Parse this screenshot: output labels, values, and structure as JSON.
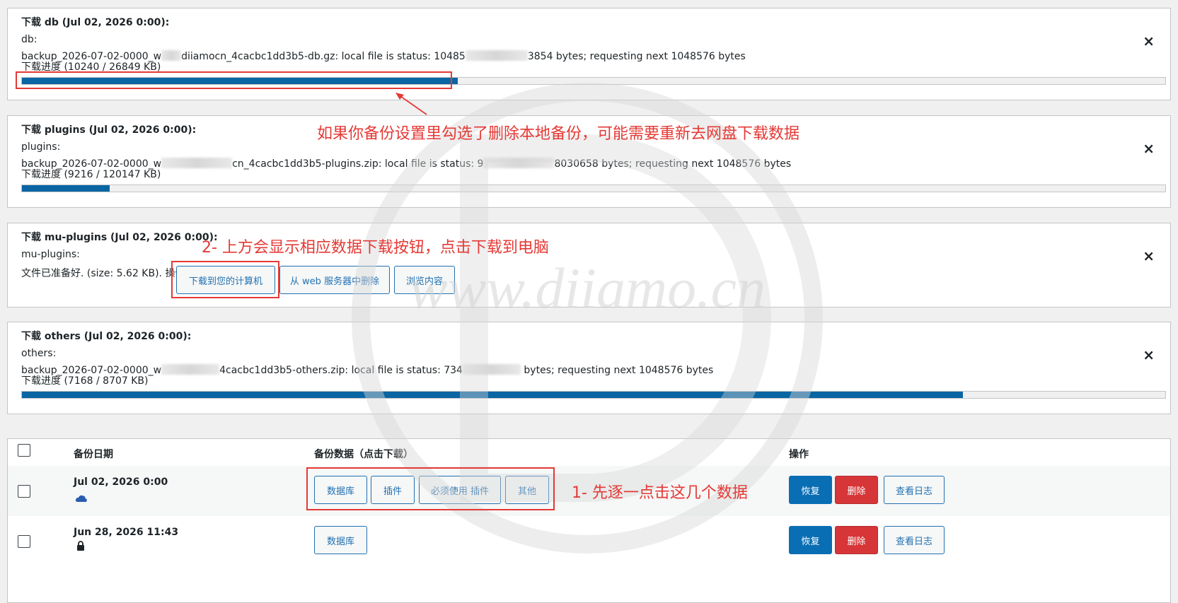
{
  "panels": [
    {
      "title": "下载 db (Jul 02, 2026 0:00):",
      "name": "db:",
      "status_a": "backup_2026-07-02-0000_w",
      "status_b": "diiamocn_4cacbc1dd3b5-db.gz: local file is status: 10485",
      "status_c": "3854 bytes; requesting next 1048576 bytes",
      "progress_text": "下载进度 (10240 / 26849 KB)",
      "progress": 0.381
    },
    {
      "title": "下载 plugins (Jul 02, 2026 0:00):",
      "name": "plugins:",
      "status_a": "backup_2026-07-02-0000_w",
      "status_b": "cn_4cacbc1dd3b5-plugins.zip: local file is status: 9",
      "status_c": "8030658 bytes; requesting next 1048576 bytes",
      "progress_text": "下载进度 (9216 / 120147 KB)",
      "progress": 0.077
    },
    {
      "title": "下载 mu-plugins (Jul 02, 2026 0:00):",
      "name": "mu-plugins:",
      "ready_text": "文件已准备好. (size: 5.62 KB). 操作",
      "buttons": [
        "下载到您的计算机",
        "从 web 服务器中删除",
        "浏览内容"
      ]
    },
    {
      "title": "下载 others (Jul 02, 2026 0:00):",
      "name": "others:",
      "status_a": "backup_2026-07-02-0000_w",
      "status_b": "4cacbc1dd3b5-others.zip: local file is status: 734",
      "status_c": "bytes; requesting next 1048576 bytes",
      "progress_text": "下载进度 (7168 / 8707 KB)",
      "progress": 0.823
    }
  ],
  "close_icon": "×",
  "table": {
    "headers": {
      "date": "备份日期",
      "data": "备份数据（点击下载）",
      "actions": "操作"
    },
    "rows": [
      {
        "date": "Jul 02, 2026 0:00",
        "icon": "cloud-icon",
        "data_buttons": [
          "数据库",
          "插件",
          "必须使用 插件",
          "其他"
        ],
        "restore": "恢复",
        "delete": "删除",
        "view_log": "查看日志"
      },
      {
        "date": "Jun 28, 2026 11:43",
        "icon": "lock-icon",
        "data_buttons": [
          "数据库"
        ],
        "restore": "恢复",
        "delete": "删除",
        "view_log": "查看日志"
      }
    ]
  },
  "annotations": {
    "note_1": "如果你备份设置里勾选了删除本地备份，可能需要重新去网盘下载数据",
    "note_2": "2- 上方会显示相应数据下载按钮，点击下载到电脑",
    "note_3": "1- 先逐一点击这几个数据"
  },
  "watermark": "www.diiamo.cn",
  "colors": {
    "accent": "#2271b1",
    "progress": "#0a65a3",
    "danger": "#d63638",
    "annotation": "#e53935"
  }
}
